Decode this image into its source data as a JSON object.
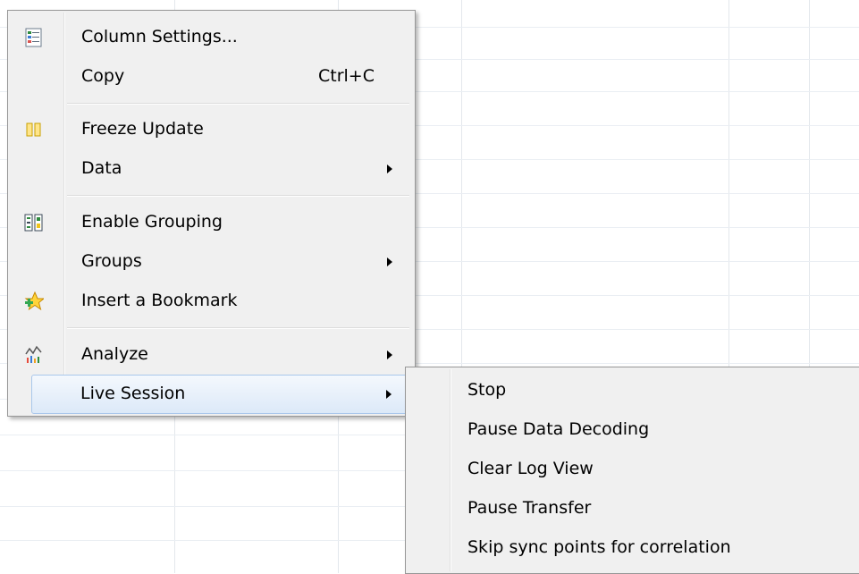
{
  "context_menu": {
    "items": [
      {
        "label": "Column Settings...",
        "icon": "column-settings-icon"
      },
      {
        "label": "Copy",
        "shortcut": "Ctrl+C"
      },
      {
        "label": "Freeze Update",
        "icon": "freeze-update-icon"
      },
      {
        "label": "Data",
        "submenu": true
      },
      {
        "label": "Enable Grouping",
        "icon": "enable-grouping-icon"
      },
      {
        "label": "Groups",
        "submenu": true
      },
      {
        "label": "Insert a Bookmark",
        "icon": "bookmark-star-icon"
      },
      {
        "label": "Analyze",
        "icon": "analyze-chart-icon",
        "submenu": true
      },
      {
        "label": "Live Session",
        "submenu": true,
        "highlighted": true
      }
    ]
  },
  "live_session_submenu": {
    "items": [
      {
        "label": "Stop"
      },
      {
        "label": "Pause Data Decoding"
      },
      {
        "label": "Clear Log View"
      },
      {
        "label": "Pause Transfer"
      },
      {
        "label": "Skip sync points for correlation"
      }
    ]
  },
  "colors": {
    "menu_background": "#f0f0f0",
    "menu_border": "#979797",
    "highlight_border": "#a9c7eb",
    "grid_line": "#eaeef3"
  }
}
